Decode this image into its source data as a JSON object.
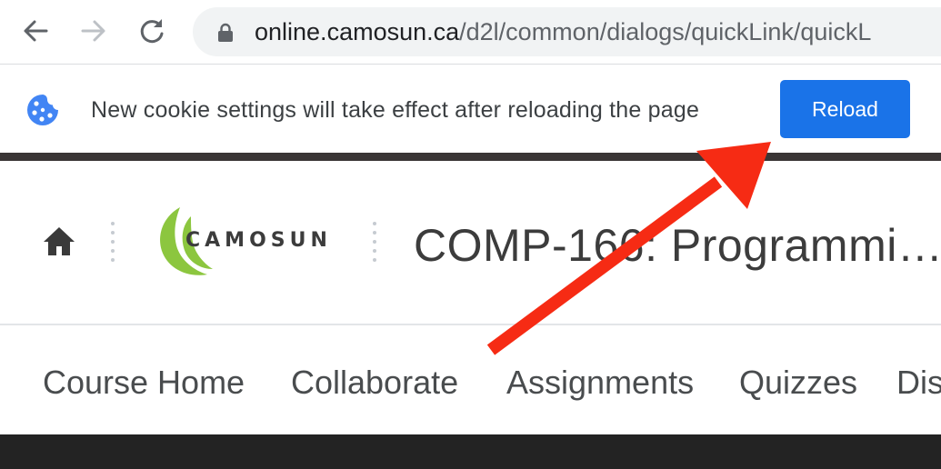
{
  "browser": {
    "url_host": "online.camosun.ca",
    "url_path": "/d2l/common/dialogs/quickLink/quickL"
  },
  "infobar": {
    "message": "New cookie settings will take effect after reloading the page",
    "reload_label": "Reload"
  },
  "header": {
    "logo_text": "CAMOSUN",
    "course_title": "COMP-166: Programmi…"
  },
  "navbar": {
    "items": [
      {
        "label": "Course Home"
      },
      {
        "label": "Collaborate"
      },
      {
        "label": "Assignments"
      },
      {
        "label": "Quizzes"
      },
      {
        "label": "Dis"
      }
    ]
  },
  "colors": {
    "reload_button": "#1a73e8",
    "arrow": "#f62b14",
    "logo_green": "#8cc63f"
  }
}
